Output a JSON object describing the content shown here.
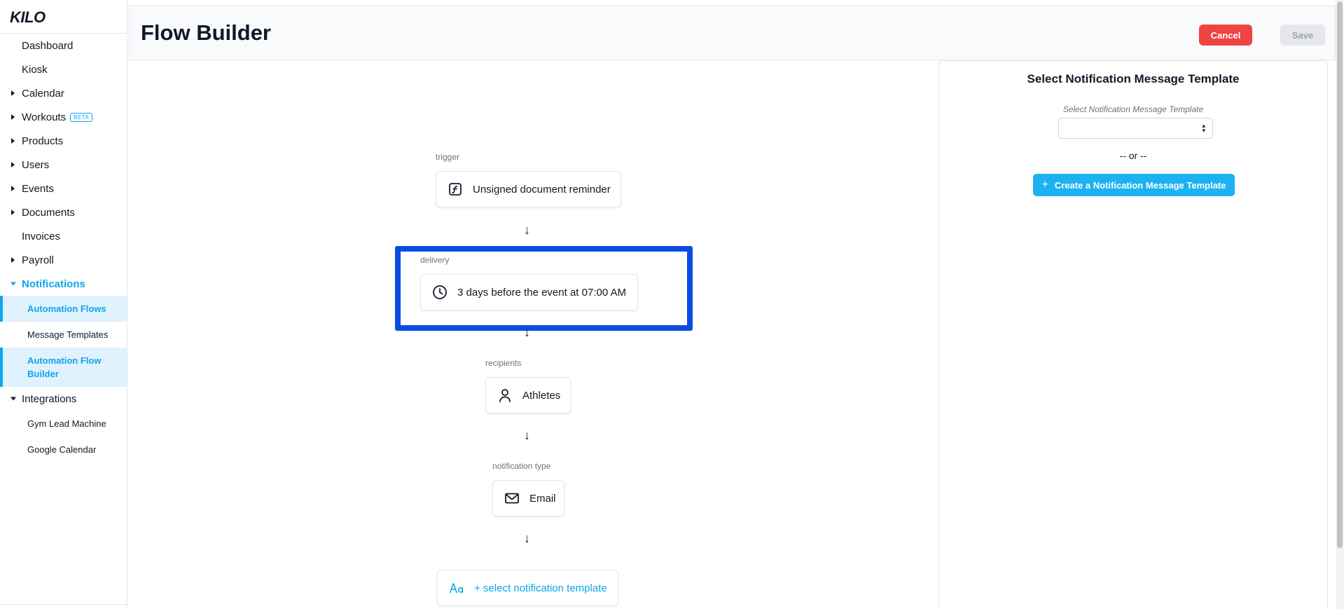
{
  "brand": {
    "logo_text": "KILO"
  },
  "sidebar": {
    "items": [
      {
        "label": "Dashboard",
        "caret": "none"
      },
      {
        "label": "Kiosk",
        "caret": "none"
      },
      {
        "label": "Calendar",
        "caret": "right"
      },
      {
        "label": "Workouts",
        "caret": "right",
        "badge": "BETA"
      },
      {
        "label": "Products",
        "caret": "right"
      },
      {
        "label": "Users",
        "caret": "right"
      },
      {
        "label": "Events",
        "caret": "right"
      },
      {
        "label": "Documents",
        "caret": "right"
      },
      {
        "label": "Invoices",
        "caret": "none"
      },
      {
        "label": "Payroll",
        "caret": "right"
      },
      {
        "label": "Notifications",
        "caret": "down",
        "active": true,
        "children": [
          {
            "label": "Automation Flows",
            "selected": true
          },
          {
            "label": "Message Templates"
          },
          {
            "label": "Automation Flow Builder",
            "selected": true
          }
        ]
      },
      {
        "label": "Integrations",
        "caret": "down",
        "children": [
          {
            "label": "Gym Lead Machine"
          },
          {
            "label": "Google Calendar"
          }
        ]
      }
    ]
  },
  "header": {
    "title": "Flow Builder",
    "cancel_label": "Cancel",
    "save_label": "Save"
  },
  "flow": {
    "trigger": {
      "label": "trigger",
      "value": "Unsigned document reminder",
      "icon": "function-icon"
    },
    "delivery": {
      "label": "delivery",
      "value": "3 days before the event at 07:00 AM",
      "icon": "clock-icon"
    },
    "recipients": {
      "label": "recipients",
      "value": "Athletes",
      "icon": "person-icon"
    },
    "notification_type": {
      "label": "notification type",
      "value": "Email",
      "icon": "mail-icon"
    },
    "template": {
      "value": "+ select notification template",
      "icon": "typography-icon"
    },
    "arrow": "↓"
  },
  "panel": {
    "title": "Select Notification Message Template",
    "select_label": "Select Notification Message Template",
    "select_value": "",
    "or_text": "-- or --",
    "create_label": "Create a Notification Message Template",
    "create_icon": "+"
  },
  "colors": {
    "accent": "#0ea5e9",
    "cancel": "#ef4444",
    "highlight": "#0b4de0",
    "create_button": "#1ab2f0"
  }
}
